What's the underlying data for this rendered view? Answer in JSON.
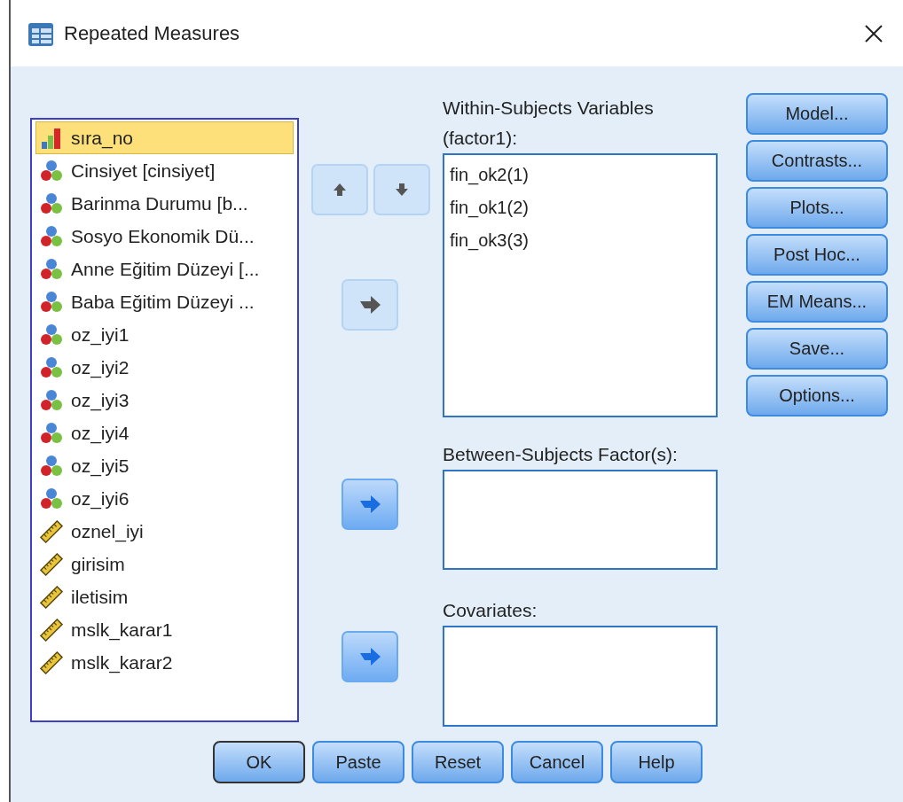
{
  "window": {
    "title": "Repeated Measures"
  },
  "variables": [
    {
      "name": "sıra_no",
      "kind": "ordinal",
      "selected": true
    },
    {
      "name": "Cinsiyet [cinsiyet]",
      "kind": "nominal",
      "selected": false
    },
    {
      "name": "Barinma Durumu [b...",
      "kind": "nominal",
      "selected": false
    },
    {
      "name": "Sosyo Ekonomik Dü...",
      "kind": "nominal",
      "selected": false
    },
    {
      "name": "Anne Eğitim Düzeyi [...",
      "kind": "nominal",
      "selected": false
    },
    {
      "name": "Baba Eğitim Düzeyi ...",
      "kind": "nominal",
      "selected": false
    },
    {
      "name": "oz_iyi1",
      "kind": "nominal",
      "selected": false
    },
    {
      "name": "oz_iyi2",
      "kind": "nominal",
      "selected": false
    },
    {
      "name": "oz_iyi3",
      "kind": "nominal",
      "selected": false
    },
    {
      "name": "oz_iyi4",
      "kind": "nominal",
      "selected": false
    },
    {
      "name": "oz_iyi5",
      "kind": "nominal",
      "selected": false
    },
    {
      "name": "oz_iyi6",
      "kind": "nominal",
      "selected": false
    },
    {
      "name": "oznel_iyi",
      "kind": "scale",
      "selected": false
    },
    {
      "name": "girisim",
      "kind": "scale",
      "selected": false
    },
    {
      "name": "iletisim",
      "kind": "scale",
      "selected": false
    },
    {
      "name": "mslk_karar1",
      "kind": "scale",
      "selected": false
    },
    {
      "name": "mslk_karar2",
      "kind": "scale",
      "selected": false
    }
  ],
  "sections": [
    {
      "label": "Within-Subjects Variables",
      "sublabel": "(factor1):",
      "items": [
        "fin_ok2(1)",
        "fin_ok1(2)",
        "fin_ok3(3)"
      ],
      "kind": "within",
      "up_disabled": true,
      "down_disabled": true,
      "move_disabled": true
    },
    {
      "label": "Between-Subjects Factor(s):",
      "kind": "between",
      "move_disabled": false
    },
    {
      "label": "Covariates:",
      "kind": "covariates",
      "move_disabled": false
    }
  ],
  "side_buttons": [
    "Model...",
    "Contrasts...",
    "Plots...",
    "Post Hoc...",
    "EM Means...",
    "Save...",
    "Options..."
  ],
  "bottom_buttons": [
    {
      "label": "OK",
      "default": true
    },
    {
      "label": "Paste",
      "default": false
    },
    {
      "label": "Reset",
      "default": false
    },
    {
      "label": "Cancel",
      "default": false
    },
    {
      "label": "Help",
      "default": false
    }
  ]
}
